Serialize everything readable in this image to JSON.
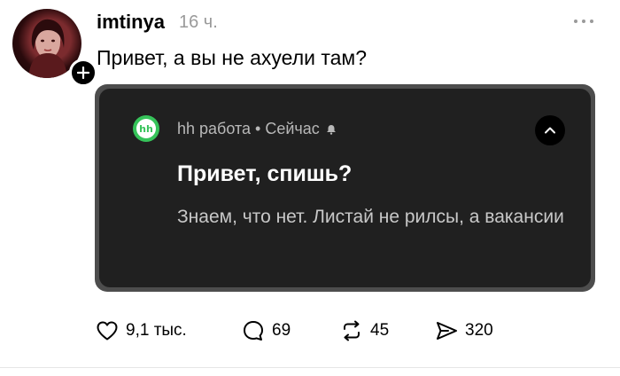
{
  "post": {
    "username": "imtinya",
    "timestamp": "16 ч.",
    "text": "Привет, а вы не ахуели там?"
  },
  "notification": {
    "app_icon_text": "hh",
    "app_line": "hh работа • Сейчас",
    "title": "Привет, спишь?",
    "body": "Знаем, что нет. Листай не рилсы, а вакансии",
    "icons": [
      "hh-app-icon",
      "bell-icon",
      "chevron-up-icon"
    ]
  },
  "actions": {
    "likes": "9,1 тыс.",
    "comments": "69",
    "reposts": "45",
    "shares": "320",
    "icons": [
      "heart-icon",
      "comment-bubble-icon",
      "repost-icon",
      "send-icon"
    ]
  },
  "colors": {
    "notification_bg": "#202020",
    "card_frame": "#4d4d4d",
    "app_green": "#36c35a",
    "muted_text": "#9a9a9a"
  }
}
